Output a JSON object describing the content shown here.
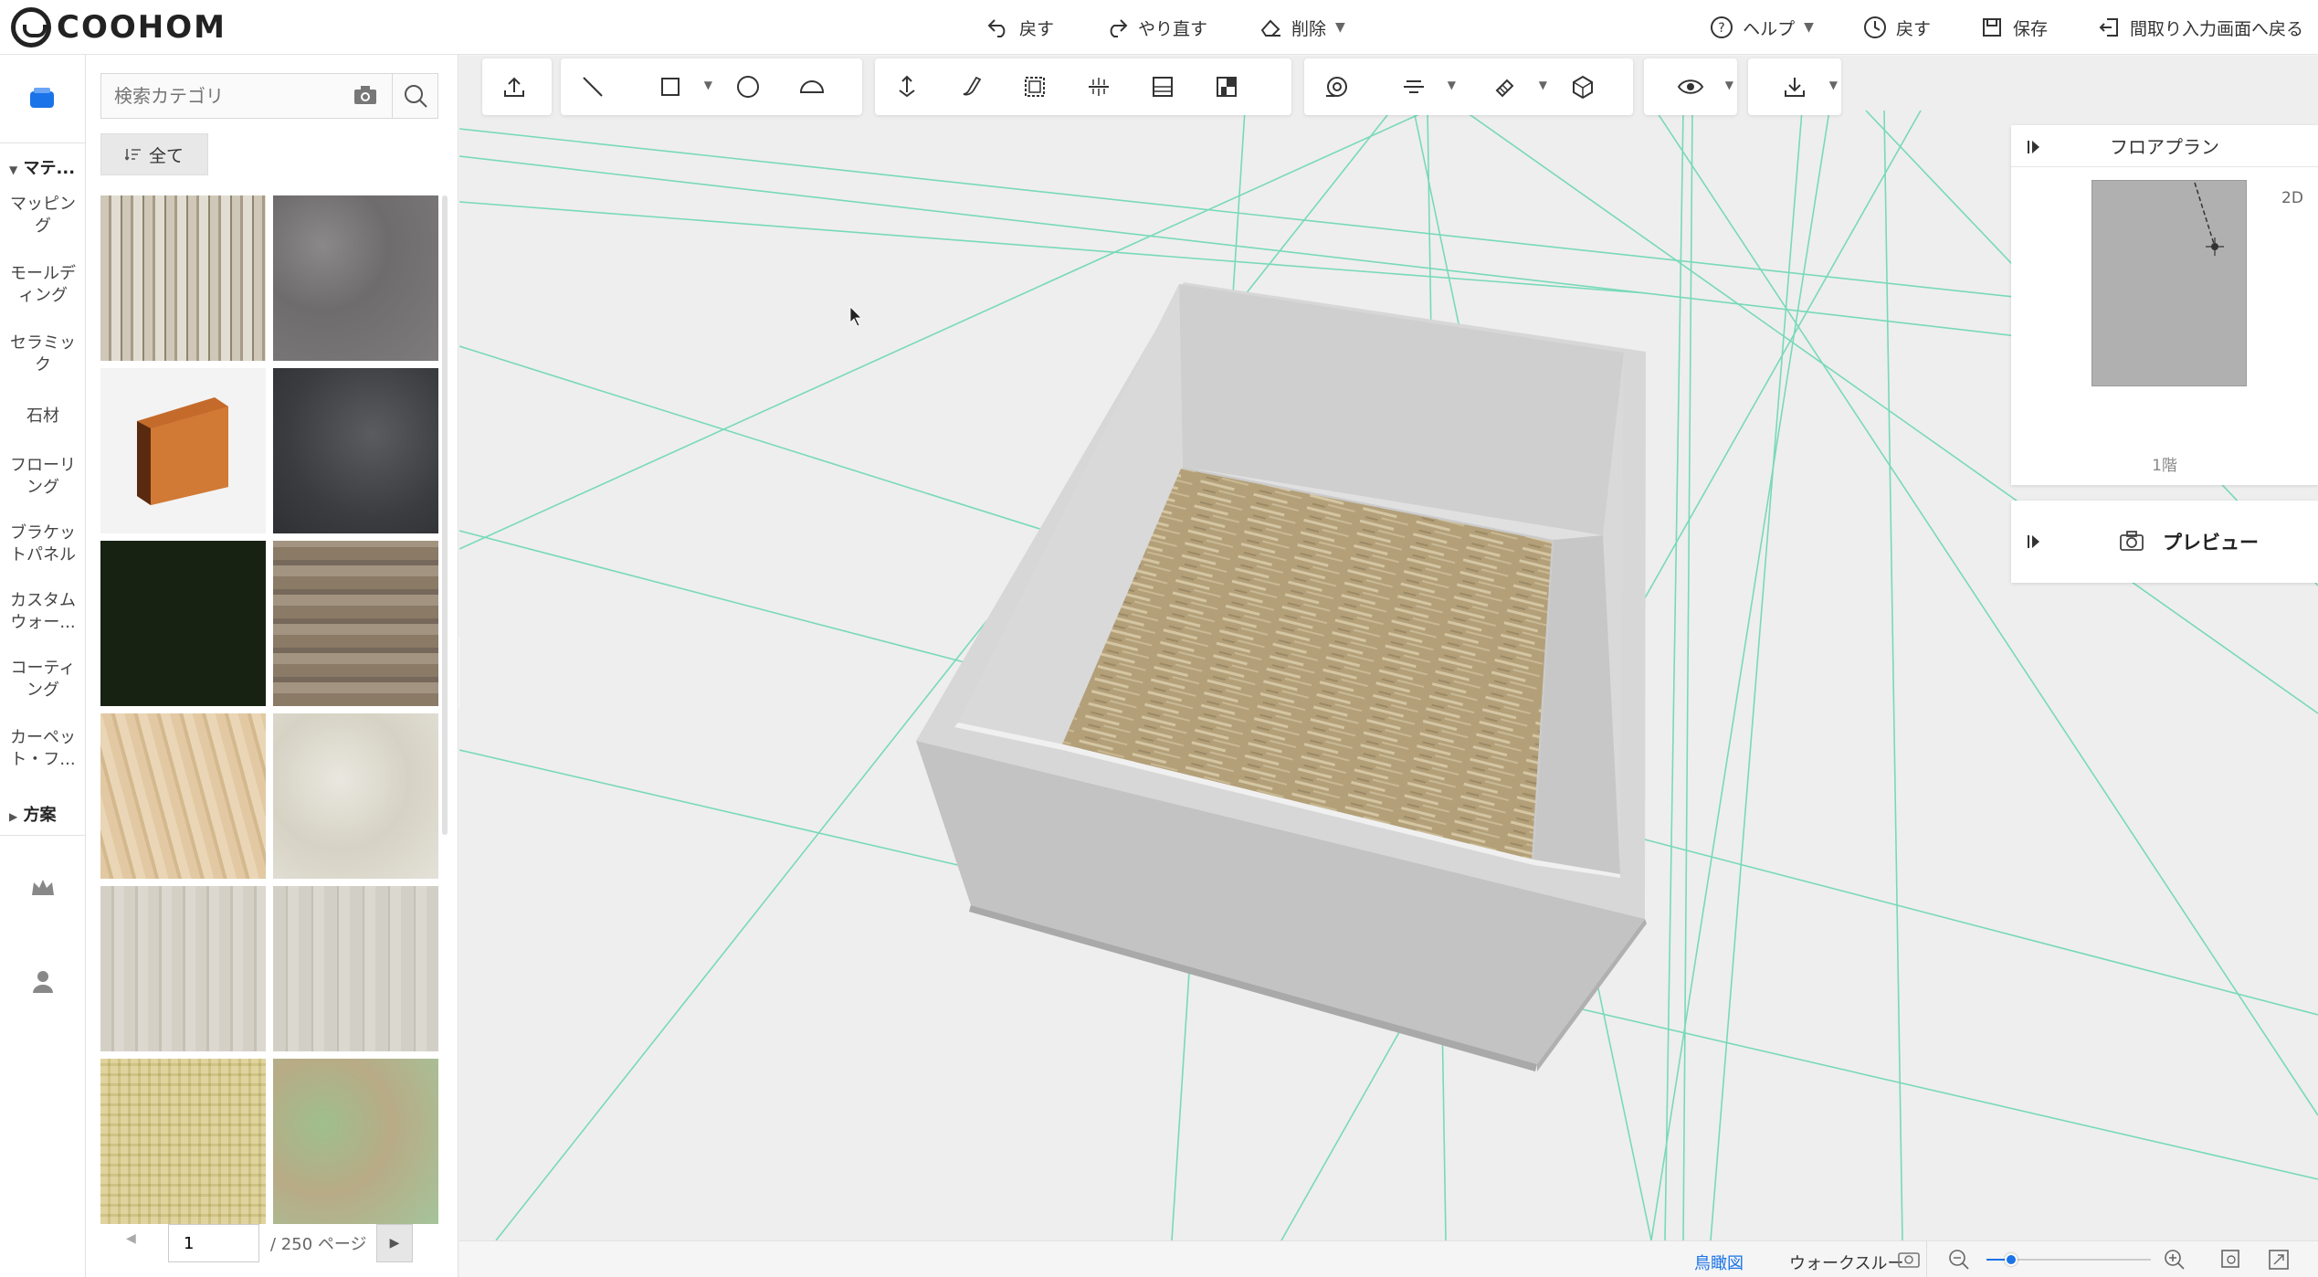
{
  "app": {
    "logo_text": "COOHOM"
  },
  "toolbar_top": {
    "undo": "戻す",
    "redo": "やり直す",
    "delete": "削除",
    "help": "ヘルプ",
    "history": "戻す",
    "save": "保存",
    "back_to_floorplan": "間取り入力画面へ戻る"
  },
  "sidebar": {
    "section_materials": "マテ...",
    "items": [
      "マッピング",
      "モールディング",
      "セラミック",
      "石材",
      "フローリング",
      "ブラケットパネル",
      "カスタムウォー...",
      "コーティング",
      "カーペット・フ..."
    ],
    "section_plans": "方案"
  },
  "panel": {
    "search_placeholder": "検索カテゴリ",
    "all_button": "全て",
    "page_value": "1",
    "page_total": "/ 250 ページ",
    "tiles": [
      {
        "name": "wood-birch"
      },
      {
        "name": "gray-carpet"
      },
      {
        "name": "skirting-board"
      },
      {
        "name": "dark-stone"
      },
      {
        "name": "dark-green"
      },
      {
        "name": "brown-wood"
      },
      {
        "name": "light-oak"
      },
      {
        "name": "marble-cream"
      },
      {
        "name": "white-wood"
      },
      {
        "name": "white-wood-2"
      },
      {
        "name": "plaid-fabric"
      },
      {
        "name": "green-terrazzo"
      }
    ]
  },
  "floorplan_panel": {
    "title": "フロアプラン",
    "mode_label": "2D",
    "floor_label": "1階"
  },
  "preview_panel": {
    "title": "プレビュー"
  },
  "bottom": {
    "view_birdseye": "鳥瞰図",
    "view_walkthrough": "ウォークスルー",
    "zoom_level": 0.15
  },
  "colors": {
    "accent": "#1a73e8",
    "guide_lines": "#5fd3ad",
    "floor_wood": "#b5a07a"
  }
}
